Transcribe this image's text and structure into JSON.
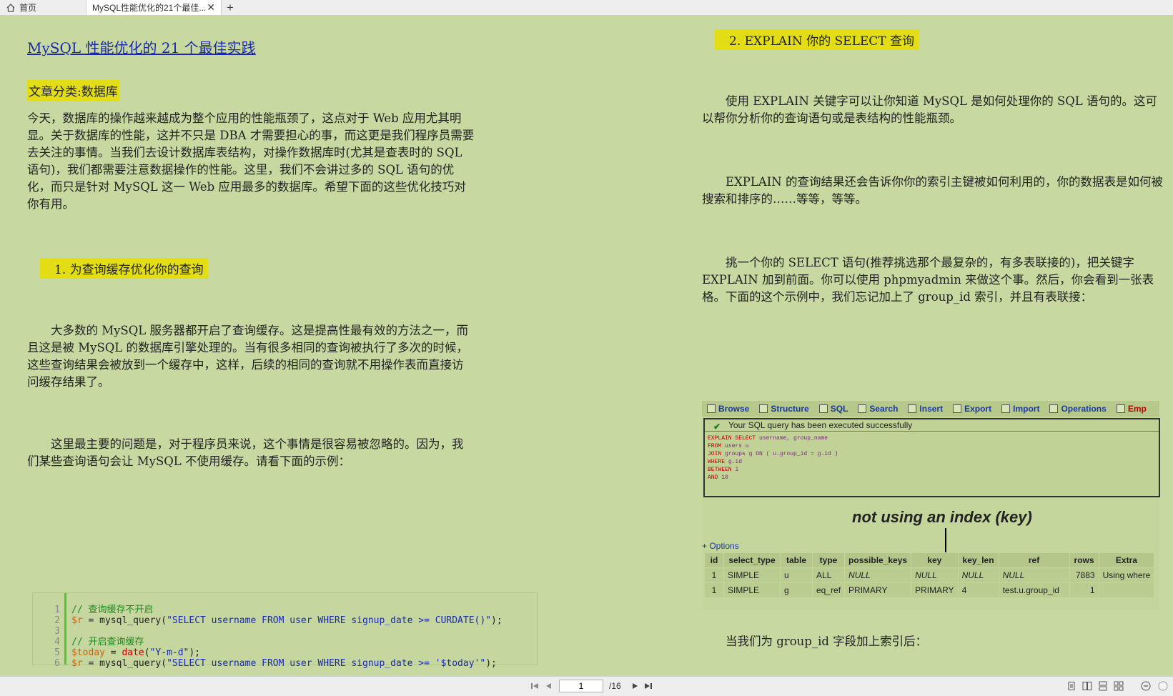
{
  "tabs": {
    "home_label": "首页",
    "active_label": "MySQL性能优化的21个最佳...",
    "close_glyph": "✕",
    "new_glyph": "+"
  },
  "left": {
    "title": "MySQL 性能优化的 21 个最佳实践",
    "category": "文章分类:数据库",
    "intro": "今天，数据库的操作越来越成为整个应用的性能瓶颈了，这点对于 Web 应用尤其明显。关于数据库的性能，这并不只是 DBA 才需要担心的事，而这更是我们程序员需要去关注的事情。当我们去设计数据库表结构，对操作数据库时(尤其是查表时的 SQL 语句)，我们都需要注意数据操作的性能。这里，我们不会讲过多的 SQL 语句的优化，而只是针对 MySQL 这一 Web 应用最多的数据库。希望下面的这些优化技巧对你有用。",
    "section1": "1.  为查询缓存优化你的查询",
    "para1": "大多数的 MySQL 服务器都开启了查询缓存。这是提高性最有效的方法之一，而且这是被 MySQL 的数据库引擎处理的。当有很多相同的查询被执行了多次的时候，这些查询结果会被放到一个缓存中，这样，后续的相同的查询就不用操作表而直接访问缓存结果了。",
    "para2": "这里最主要的问题是，对于程序员来说，这个事情是很容易被忽略的。因为，我们某些查询语句会让 MySQL 不使用缓存。请看下面的示例："
  },
  "code": {
    "line_numbers": [
      "1",
      "2",
      "3",
      "4",
      "5",
      "6"
    ],
    "line1_comment": "// 查询缓存不开启",
    "line2_var": "$r",
    "line2_mid": " = mysql_query(",
    "line2_str": "\"SELECT username FROM user WHERE signup_date >= CURDATE()\"",
    "line2_end": ");",
    "line4_comment": "// 开启查询缓存",
    "line5_var": "$today",
    "line5_mid": " = ",
    "line5_fn": "date",
    "line5_open": "(",
    "line5_str": "\"Y-m-d\"",
    "line5_end": ");",
    "line6_var": "$r",
    "line6_mid": " = mysql_query(",
    "line6_str": "\"SELECT username FROM user WHERE signup_date >= '$today'\"",
    "line6_end": ");"
  },
  "right": {
    "section2": "2.  EXPLAIN 你的 SELECT 查询",
    "para1": "使用 EXPLAIN 关键字可以让你知道 MySQL 是如何处理你的 SQL 语句的。这可以帮你分析你的查询语句或是表结构的性能瓶颈。",
    "para2": "EXPLAIN 的查询结果还会告诉你你的索引主键被如何利用的，你的数据表是如何被搜索和排序的……等等，等等。",
    "para3": "挑一个你的 SELECT 语句(推荐挑选那个最复杂的，有多表联接的)，把关键字 EXPLAIN 加到前面。你可以使用 phpmyadmin 来做这个事。然后，你会看到一张表格。下面的这个示例中，我们忘记加上了 group_id 索引，并且有表联接：",
    "para4": "当我们为 group_id 字段加上索引后："
  },
  "screenshot": {
    "tabs": [
      "Browse",
      "Structure",
      "SQL",
      "Search",
      "Insert",
      "Export",
      "Import",
      "Operations",
      "Emp"
    ],
    "success": "Your SQL query has been executed successfully",
    "sql_lines": [
      [
        "EXPLAIN SELECT",
        " username, group_name"
      ],
      [
        "FROM",
        " users u"
      ],
      [
        "JOIN",
        " groups g ON ( u.group_id = g.id )"
      ],
      [
        "WHERE",
        " g.id"
      ],
      [
        "BETWEEN",
        " 1"
      ],
      [
        "AND",
        " 10"
      ]
    ],
    "caption": "not using an index (key)",
    "options": "+ Options",
    "columns": [
      "id",
      "select_type",
      "table",
      "type",
      "possible_keys",
      "key",
      "key_len",
      "ref",
      "rows",
      "Extra"
    ],
    "rows": [
      [
        "1",
        "SIMPLE",
        "u",
        "ALL",
        "NULL",
        "NULL",
        "NULL",
        "NULL",
        "7883",
        "Using where"
      ],
      [
        "1",
        "SIMPLE",
        "g",
        "eq_ref",
        "PRIMARY",
        "PRIMARY",
        "4",
        "test.u.group_id",
        "1",
        ""
      ]
    ]
  },
  "bottom": {
    "page_value": "1",
    "page_total": "/16"
  }
}
